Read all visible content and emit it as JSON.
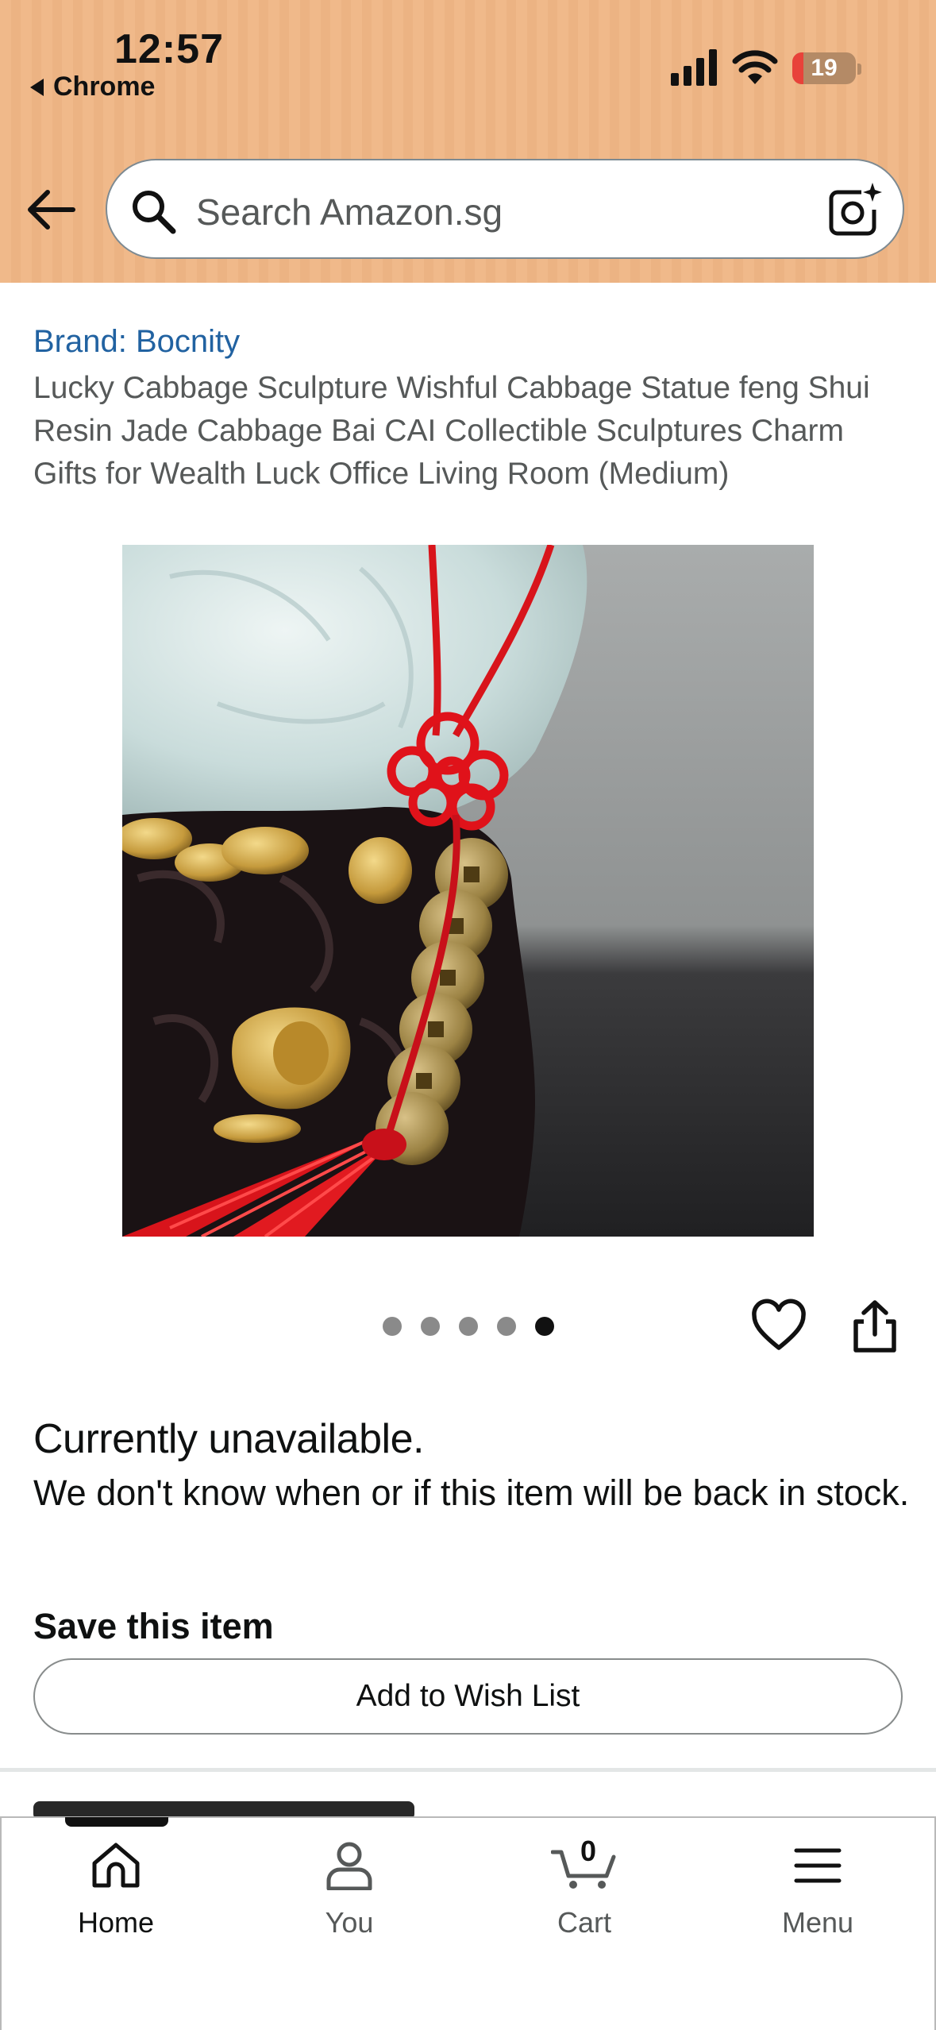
{
  "status_bar": {
    "time": "12:57",
    "back_app": "Chrome",
    "battery": "19"
  },
  "search": {
    "placeholder": "Search Amazon.sg"
  },
  "product": {
    "brand": "Brand: Bocnity",
    "title": "Lucky Cabbage Sculpture Wishful Cabbage Statue feng Shui Resin Jade Cabbage Bai CAI Collectible Sculptures Charm Gifts for Wealth Luck Office Living Room (Medium)",
    "image_count": 5,
    "active_image": 5
  },
  "availability": {
    "heading": "Currently unavailable.",
    "message": "We don't know when or if this item will be back in stock."
  },
  "save": {
    "heading": "Save this item",
    "button": "Add to Wish List"
  },
  "cart": {
    "count": "0"
  },
  "tabs": [
    {
      "label": "Home",
      "icon": "home-icon",
      "active": true
    },
    {
      "label": "You",
      "icon": "user-icon",
      "active": false
    },
    {
      "label": "Cart",
      "icon": "cart-icon",
      "active": false
    },
    {
      "label": "Menu",
      "icon": "menu-icon",
      "active": false
    }
  ],
  "colors": {
    "header_bg": "#f0b98a",
    "brand_link": "#2162a1",
    "text": "#0f1111",
    "muted": "#565959"
  }
}
